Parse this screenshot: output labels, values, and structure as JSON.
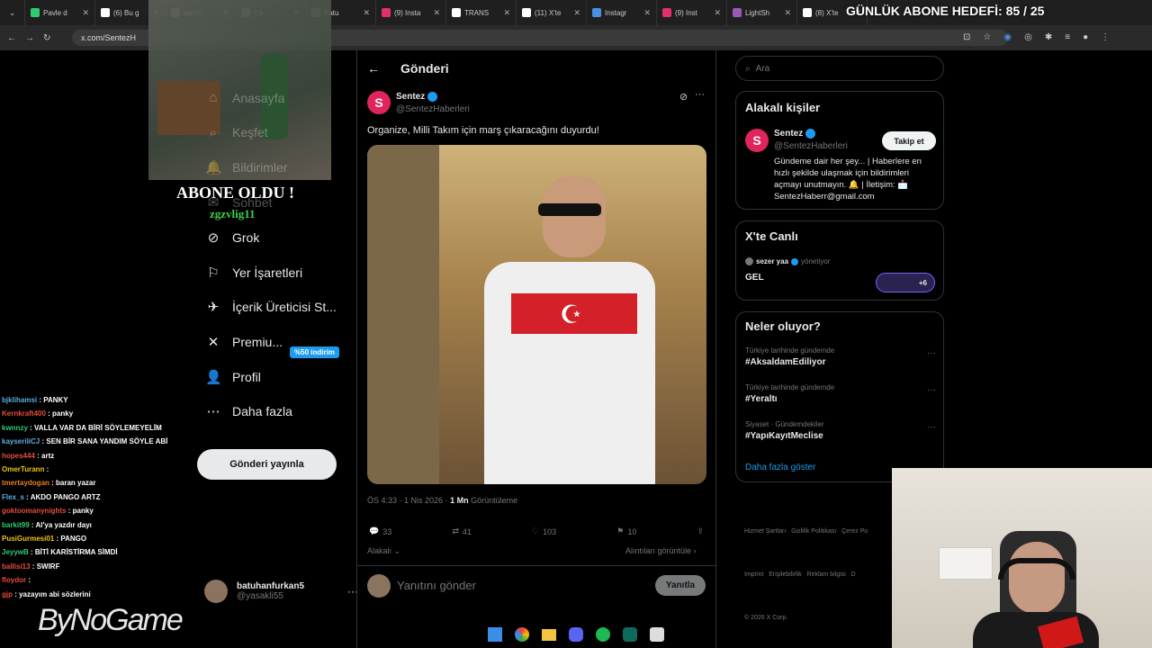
{
  "browser": {
    "tabs": [
      {
        "label": "Pavle d",
        "color": "#2ecc71"
      },
      {
        "label": "(6) Bu g",
        "color": "#ffffff"
      },
      {
        "label": "batuh",
        "color": "#888888"
      },
      {
        "label": "Ce",
        "color": "#888888"
      },
      {
        "label": "Batu",
        "color": "#888888"
      },
      {
        "label": "(9) Insta",
        "color": "#e1306c"
      },
      {
        "label": "TRANS",
        "color": "#ffffff"
      },
      {
        "label": "(11) X'te",
        "color": "#ffffff"
      },
      {
        "label": "Instagr",
        "color": "#4a90e2"
      },
      {
        "label": "(9) Inst",
        "color": "#e1306c"
      },
      {
        "label": "LightSh",
        "color": "#9b59b6"
      },
      {
        "label": "(8) X'te",
        "color": "#ffffff"
      }
    ],
    "url": "x.com/SentezH",
    "goal_overlay": "GÜNLÜK ABONE HEDEFİ: 85 / 25"
  },
  "overlay": {
    "sub_title": "ABONE OLDU !",
    "sub_user": "zgzvlig11",
    "logo": "ByNoGame"
  },
  "nav": {
    "items": [
      {
        "label": "Anasayfa"
      },
      {
        "label": "Keşfet"
      },
      {
        "label": "Bildirimler"
      },
      {
        "label": "Sohbet"
      },
      {
        "label": "Grok"
      },
      {
        "label": "Yer İşaretleri"
      },
      {
        "label": "İçerik Üreticisi St..."
      },
      {
        "label": "Premiu..."
      },
      {
        "label": "Profil"
      },
      {
        "label": "Daha fazla"
      }
    ],
    "premium_badge": "%50 indirim",
    "post_button": "Gönderi yayınla",
    "account_name": "batuhanfurkan5",
    "account_handle": "@yasakli55"
  },
  "post": {
    "header": "Gönderi",
    "author_name": "Sentez",
    "author_handle": "@SentezHaberleri",
    "avatar_letter": "S",
    "text": "Organize, Milli Takım için marş çıkaracağını duyurdu!",
    "timestamp": "ÖS 4:33 · 1 Nis 2026 ·",
    "views": "1 Mn",
    "views_label": "Görüntüleme",
    "replies": "33",
    "reposts": "41",
    "likes": "103",
    "bookmarks": "10",
    "relevant": "Alakalı",
    "quotes": "Alıntıları görüntüle",
    "reply_placeholder": "Yanıtını gönder",
    "reply_button": "Yanıtla"
  },
  "right": {
    "search_placeholder": "Ara",
    "related_title": "Alakalı kişiler",
    "related_name": "Sentez",
    "related_handle": "@SentezHaberleri",
    "follow_button": "Takip et",
    "related_bio": "Gündeme dair her şey... | Haberlere en hızlı şekilde ulaşmak için bildirimleri açmayı unutmayın. 🔔 | İletişim: 📩 SentezHaberr@gmail.com",
    "live_title": "X'te Canlı",
    "live_host": "sezer yaa",
    "live_host_suffix": "yönetiyor",
    "live_name": "GEL",
    "live_count": "+6",
    "trends_title": "Neler oluyor?",
    "trends": [
      {
        "context": "Türkiye tarihinde gündemde",
        "tag": "#AksaldamEdiliyor"
      },
      {
        "context": "Türkiye tarihinde gündemde",
        "tag": "#Yeraltı"
      },
      {
        "context": "Siyaset · Gündemdekiler",
        "tag": "#YapıKayıtMeclise"
      }
    ],
    "show_more": "Daha fazla göster",
    "footer1": "Hizmet Şartları   Gizlilik Politikası   Çerez Po",
    "footer2": "Imprint   Erişilebilirlik   Reklam bilgisi   D",
    "footer3": "© 2026 X Corp."
  },
  "chat": [
    {
      "user": "bjklihamsi",
      "msg": " : PANKY",
      "color": "#5dade2"
    },
    {
      "user": "Kernkraft400",
      "msg": " : panky",
      "color": "#e74c3c"
    },
    {
      "user": "kwnnzy",
      "msg": " : VALLA VAR DA BİRİ SÖYLEMEYELİM",
      "color": "#2ecc71"
    },
    {
      "user": "kayseriliCJ",
      "msg": " : SEN BİR SANA YANDIM SÖYLE ABİ",
      "color": "#5dade2"
    },
    {
      "user": "hopes444",
      "msg": " : artz",
      "color": "#e74c3c"
    },
    {
      "user": "OmerTurann",
      "msg": " : ",
      "color": "#f1c40f"
    },
    {
      "user": "tmertaydogan",
      "msg": " : baran yazar",
      "color": "#e67e22"
    },
    {
      "user": "Flex_s",
      "msg": " : AKDO PANGO ARTZ",
      "color": "#5dade2"
    },
    {
      "user": "goktoomanynights",
      "msg": " : panky",
      "color": "#e74c3c"
    },
    {
      "user": "barkit99",
      "msg": " : Al'ya yazdır dayı",
      "color": "#2ecc71"
    },
    {
      "user": "PusiGurmesi01",
      "msg": " : PANGO",
      "color": "#f1c40f"
    },
    {
      "user": "JeyywB",
      "msg": " : BİTİ KARİSTİRMA SİMDİ",
      "color": "#2ecc71"
    },
    {
      "user": "ballisi13",
      "msg": " : SWIRF",
      "color": "#e74c3c"
    },
    {
      "user": "floydor",
      "msg": " : ",
      "color": "#e74c3c"
    },
    {
      "user": "gjp",
      "msg": " : yazayım abi sözlerini",
      "color": "#e74c3c"
    }
  ]
}
